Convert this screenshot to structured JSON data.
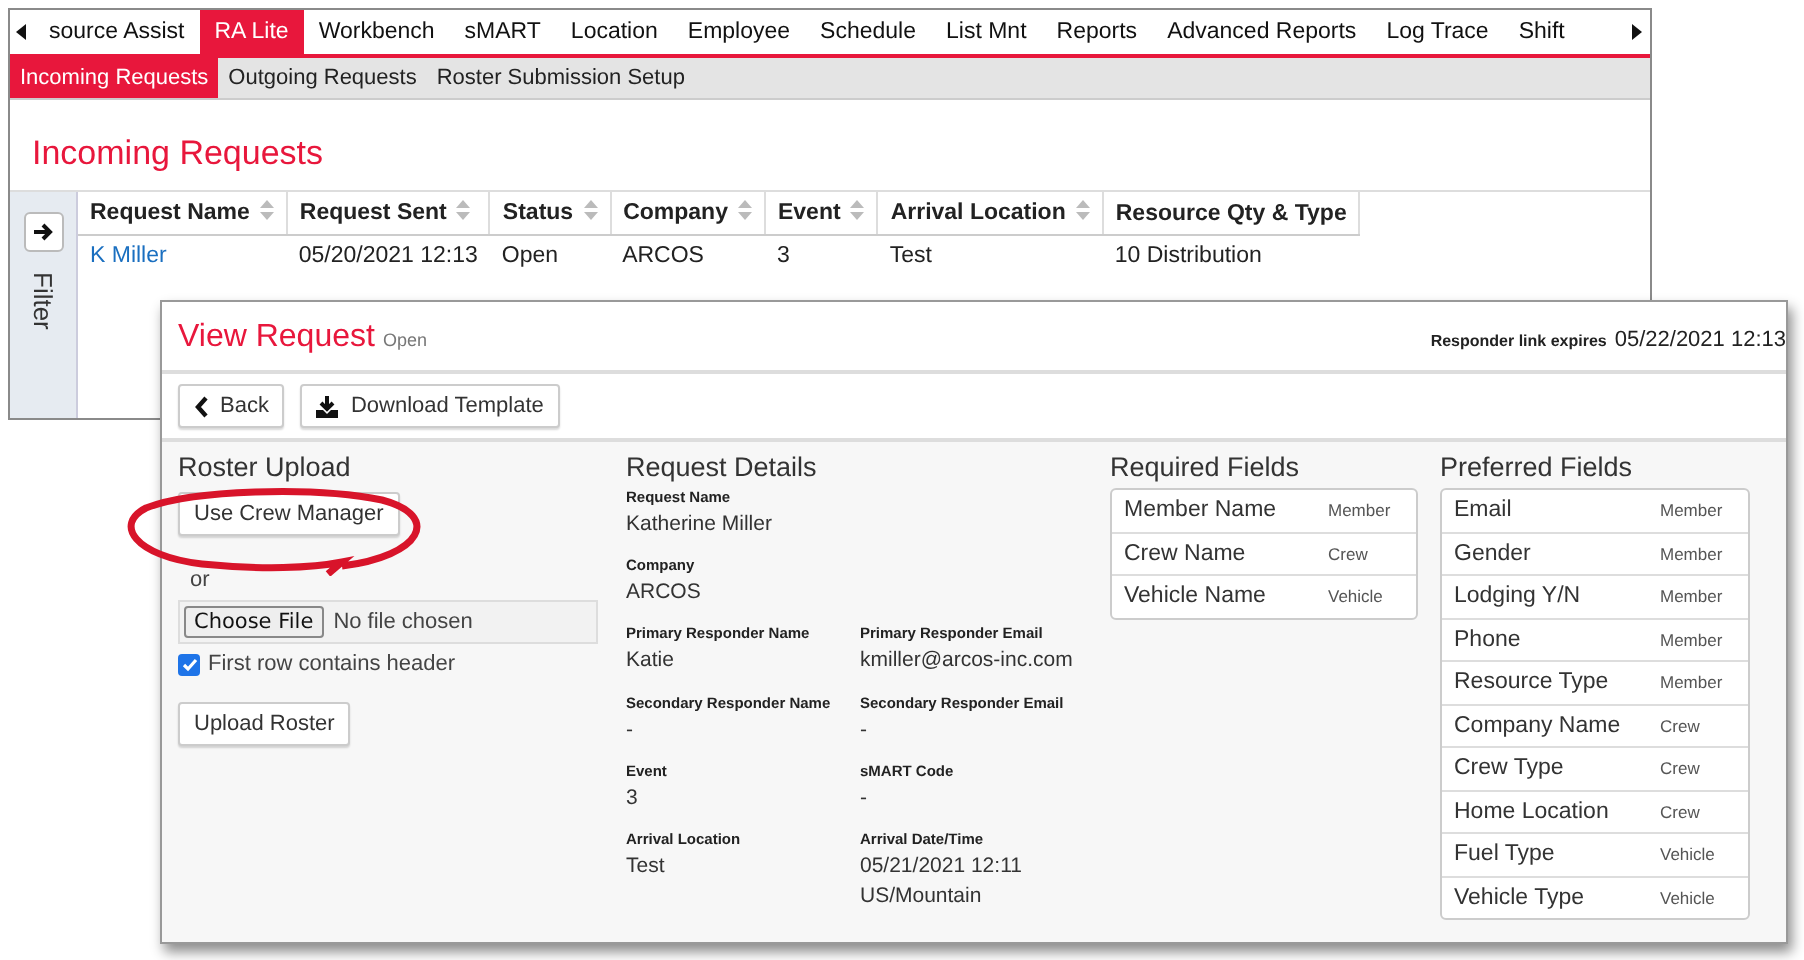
{
  "nav": {
    "tabs": [
      {
        "label": "source Assist",
        "selected": false
      },
      {
        "label": "RA Lite",
        "selected": true
      },
      {
        "label": "Workbench",
        "selected": false
      },
      {
        "label": "sMART",
        "selected": false
      },
      {
        "label": "Location",
        "selected": false
      },
      {
        "label": "Employee",
        "selected": false
      },
      {
        "label": "Schedule",
        "selected": false
      },
      {
        "label": "List Mnt",
        "selected": false
      },
      {
        "label": "Reports",
        "selected": false
      },
      {
        "label": "Advanced Reports",
        "selected": false
      },
      {
        "label": "Log Trace",
        "selected": false
      },
      {
        "label": "Shift",
        "selected": false
      }
    ]
  },
  "subtabs": [
    {
      "label": "Incoming Requests",
      "selected": true
    },
    {
      "label": "Outgoing Requests",
      "selected": false
    },
    {
      "label": "Roster Submission Setup",
      "selected": false
    }
  ],
  "page_title": "Incoming Requests",
  "filter_label": "Filter",
  "table": {
    "columns": [
      {
        "label": "Request Name",
        "sortable": true,
        "link": true
      },
      {
        "label": "Request Sent",
        "sortable": true,
        "link": false
      },
      {
        "label": "Status",
        "sortable": true,
        "link": false
      },
      {
        "label": "Company",
        "sortable": true,
        "link": false
      },
      {
        "label": "Event",
        "sortable": true,
        "link": false
      },
      {
        "label": "Arrival Location",
        "sortable": true,
        "link": false
      },
      {
        "label": "Resource Qty & Type",
        "sortable": false,
        "link": false
      }
    ],
    "rows": [
      [
        "K Miller",
        "05/20/2021 12:13",
        "Open",
        "ARCOS",
        "3",
        "Test",
        "10 Distribution"
      ]
    ]
  },
  "dialog": {
    "title": "View Request",
    "status": "Open",
    "expiry_label": "Responder link expires",
    "expiry_value": "05/22/2021 12:13",
    "buttons": [
      {
        "label": "Back",
        "kind": "back"
      },
      {
        "label": "Download Template",
        "kind": "download"
      }
    ],
    "roster": {
      "heading": "Roster Upload",
      "crew_button": "Use Crew Manager",
      "or": "or",
      "file_button": "Choose File",
      "file_status": "No file chosen",
      "header_checkbox": {
        "label": "First row contains header",
        "checked": true
      },
      "upload_button": "Upload Roster",
      "highlighted": true
    },
    "details": {
      "heading": "Request Details",
      "rows": [
        [
          {
            "label": "Request Name",
            "value": "Katherine Miller"
          }
        ],
        [
          {
            "label": "Company",
            "value": "ARCOS"
          }
        ],
        [
          {
            "label": "Primary Responder Name",
            "value": "Katie"
          },
          {
            "label": "Primary Responder Email",
            "value": "kmiller@arcos-inc.com"
          }
        ],
        [
          {
            "label": "Secondary Responder Name",
            "value": "-"
          },
          {
            "label": "Secondary Responder Email",
            "value": "-"
          }
        ],
        [
          {
            "label": "Event",
            "value": "3"
          },
          {
            "label": "sMART Code",
            "value": "-"
          }
        ],
        [
          {
            "label": "Arrival Location",
            "value": "Test"
          },
          {
            "label": "Arrival Date/Time",
            "value": "05/21/2021 12:11\nUS/Mountain"
          }
        ]
      ]
    },
    "required": {
      "heading": "Required Fields",
      "items": [
        {
          "name": "Member Name",
          "group": "Member"
        },
        {
          "name": "Crew Name",
          "group": "Crew"
        },
        {
          "name": "Vehicle Name",
          "group": "Vehicle"
        }
      ]
    },
    "preferred": {
      "heading": "Preferred Fields",
      "items": [
        {
          "name": "Email",
          "group": "Member"
        },
        {
          "name": "Gender",
          "group": "Member"
        },
        {
          "name": "Lodging Y/N",
          "group": "Member"
        },
        {
          "name": "Phone",
          "group": "Member"
        },
        {
          "name": "Resource Type",
          "group": "Member"
        },
        {
          "name": "Company Name",
          "group": "Crew"
        },
        {
          "name": "Crew Type",
          "group": "Crew"
        },
        {
          "name": "Home Location",
          "group": "Crew"
        },
        {
          "name": "Fuel Type",
          "group": "Vehicle"
        },
        {
          "name": "Vehicle Type",
          "group": "Vehicle"
        }
      ]
    }
  }
}
